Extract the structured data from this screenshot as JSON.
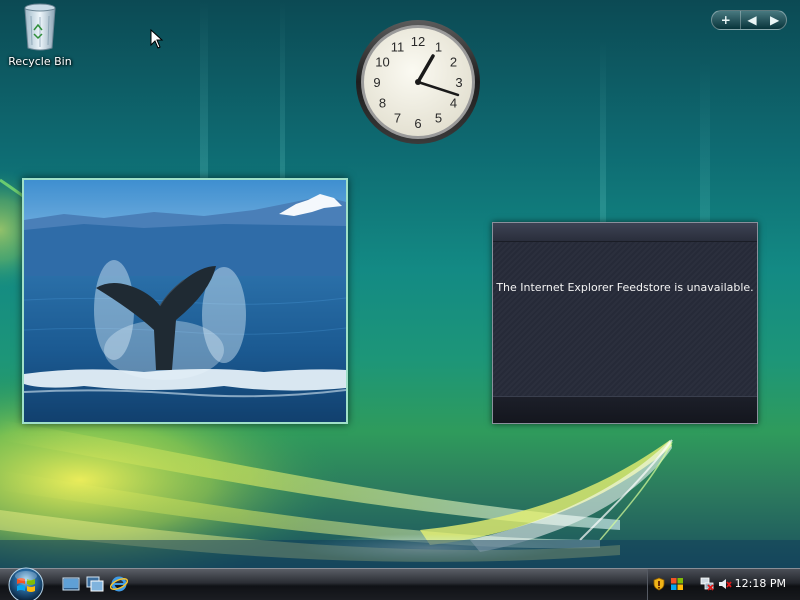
{
  "desktop": {
    "icons": [
      {
        "label": "Recycle Bin",
        "icon": "recycle-bin-icon"
      }
    ]
  },
  "sidebar_control": {
    "add_glyph": "+",
    "prev_glyph": "◀",
    "next_glyph": "▶"
  },
  "clock_gadget": {
    "numerals": [
      "12",
      "1",
      "2",
      "3",
      "4",
      "5",
      "6",
      "7",
      "8",
      "9",
      "10",
      "11"
    ],
    "hour_hand_angle": 30,
    "minute_hand_angle": 108
  },
  "slideshow_gadget": {
    "image": "whale-tail-photo"
  },
  "feed_gadget": {
    "message": "The Internet Explorer Feedstore is unavailable."
  },
  "taskbar": {
    "start_icon": "windows-start-orb-icon",
    "quick_launch": [
      "show-desktop-icon",
      "switch-windows-icon",
      "internet-explorer-icon"
    ],
    "tray_icons": [
      "security-shield-icon",
      "windows-update-icon",
      "network-disconnected-icon",
      "volume-muted-icon"
    ],
    "time": "12:18 PM"
  },
  "colors": {
    "feed_background": "#262a38",
    "taskbar_background": "#1b1d22",
    "slideshow_border": "#9fe0c8"
  }
}
